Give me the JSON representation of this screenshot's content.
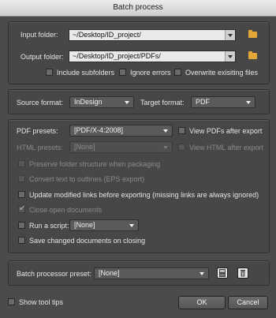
{
  "window": {
    "title": "Batch process"
  },
  "folders": {
    "input_label": "Input folder:",
    "input_value": "~/Desktop/ID_project/",
    "output_label": "Output folder:",
    "output_value": "~/Desktop/ID_project/PDFs/",
    "include_subfolders": "Include subfolders",
    "ignore_errors": "Ignore errors",
    "overwrite": "Overwrite exisiting files"
  },
  "formats": {
    "source_label": "Source format:",
    "source_value": "InDesign",
    "target_label": "Target format:",
    "target_value": "PDF"
  },
  "options": {
    "pdf_presets_label": "PDF presets:",
    "pdf_presets_value": "[PDF/X-4:2008]",
    "view_pdfs": "View PDFs after export",
    "html_presets_label": "HTML presets:",
    "html_presets_value": "[None]",
    "view_html": "View HTML after export",
    "preserve_folder": "Preserve folder structure when packaging",
    "convert_outlines": "Convert text to outlines (EPS export)",
    "update_links": "Update modified links before exporting (missing links are always ignored)",
    "close_docs": "Close open documents",
    "run_script_label": "Run a script:",
    "run_script_value": "[None]",
    "save_changed": "Save changed documents on closing"
  },
  "preset": {
    "label": "Batch processor preset:",
    "value": "[None]"
  },
  "footer": {
    "show_tooltips": "Show tool tips",
    "ok": "OK",
    "cancel": "Cancel"
  },
  "colors": {
    "folder_icon": "#e2a737",
    "background": "#4b4b4b"
  }
}
